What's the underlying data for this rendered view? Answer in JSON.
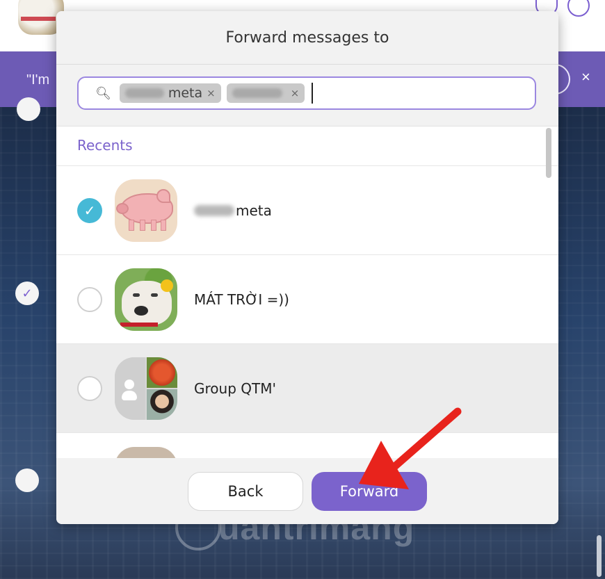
{
  "background": {
    "banner_text": "\"I'm",
    "banner_close": "×",
    "watermark": "uantrimang"
  },
  "dialog": {
    "title": "Forward messages to",
    "search": {
      "chips": [
        {
          "visible_text": "meta",
          "remove": "×"
        },
        {
          "visible_text": "",
          "remove": "×"
        }
      ]
    },
    "section_title": "Recents",
    "contacts": [
      {
        "name": "meta",
        "selected": true,
        "name_partially_obscured": true
      },
      {
        "name": "MÁT TRỜI =))",
        "selected": false
      },
      {
        "name": "Group QTM'",
        "selected": false,
        "highlighted": true
      },
      {
        "name": "",
        "selected": false,
        "partially_visible": true
      }
    ],
    "buttons": {
      "back": "Back",
      "forward": "Forward"
    }
  },
  "colors": {
    "accent": "#7b63cc",
    "selected_check": "#46b9d6",
    "banner": "#6d5bb5",
    "annotation_arrow": "#e8231c"
  }
}
